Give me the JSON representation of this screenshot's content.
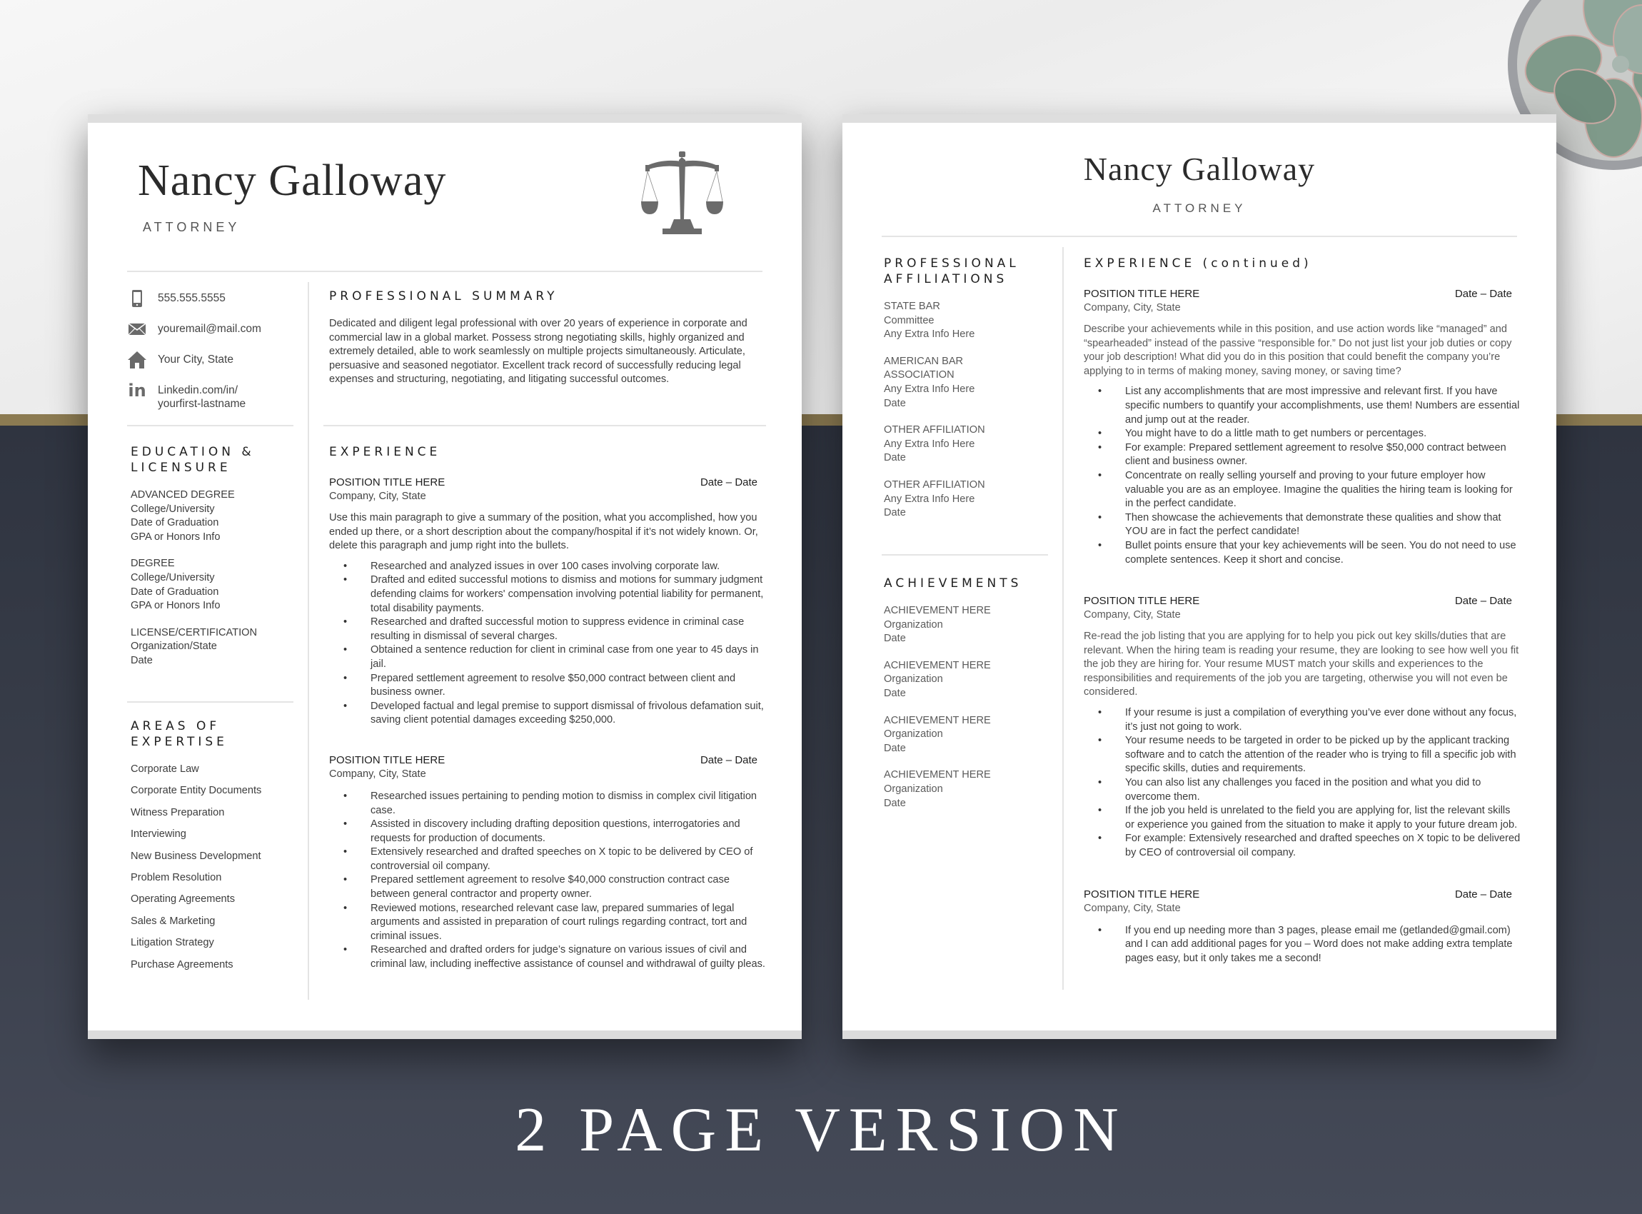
{
  "caption": "2 PAGE VERSION",
  "colors": {
    "gold_band": "#8c7b52",
    "dark_bg": "#353a46",
    "heading": "#1e1e1e",
    "body_text": "#3d3d3d"
  },
  "page1": {
    "name": "Nancy Galloway",
    "title": "ATTORNEY",
    "logo_icon": "scales-of-justice-icon",
    "contact": [
      {
        "icon": "phone-icon",
        "text": "555.555.5555"
      },
      {
        "icon": "mail-icon",
        "text": "youremail@mail.com"
      },
      {
        "icon": "home-icon",
        "text": "Your City, State"
      },
      {
        "icon": "linkedin-icon",
        "line1": "Linkedin.com/in/",
        "line2": "yourfirst-lastname"
      }
    ],
    "education": {
      "heading_line1": "EDUCATION &",
      "heading_line2": "LICENSURE",
      "entries": [
        {
          "title": "ADVANCED DEGREE",
          "lines": [
            "College/University",
            "Date of Graduation",
            "GPA or Honors Info"
          ]
        },
        {
          "title": "DEGREE",
          "lines": [
            "College/University",
            "Date of Graduation",
            "GPA or Honors Info"
          ]
        },
        {
          "title": "LICENSE/CERTIFICATION",
          "lines": [
            "Organization/State",
            "Date"
          ]
        }
      ]
    },
    "expertise": {
      "heading_line1": "AREAS OF",
      "heading_line2": "EXPERTISE",
      "items": [
        "Corporate Law",
        "Corporate Entity Documents",
        "Witness Preparation",
        "Interviewing",
        "New Business Development",
        "Problem Resolution",
        "Operating Agreements",
        "Sales & Marketing",
        "Litigation Strategy",
        "Purchase Agreements"
      ]
    },
    "summary": {
      "heading": "PROFESSIONAL SUMMARY",
      "text": "Dedicated and diligent legal professional with over 20 years of experience in corporate and commercial law in a global market.  Possess strong negotiating skills, highly organized and extremely detailed, able to work seamlessly on multiple projects simultaneously.  Articulate, persuasive and seasoned negotiator.  Excellent track record of successfully reducing legal expenses and structuring, negotiating, and litigating successful outcomes."
    },
    "experience": {
      "heading": "EXPERIENCE",
      "jobs": [
        {
          "title": "POSITION TITLE HERE",
          "dates": "Date – Date",
          "company": "Company, City, State",
          "summary": "Use this main paragraph to give a summary of the position, what you accomplished, how you ended up there, or a short description about the company/hospital if it’s not widely known.  Or, delete this paragraph and jump right into the bullets.",
          "bullets": [
            "Researched and analyzed issues in over 100 cases involving corporate law.",
            "Drafted and edited successful motions to dismiss and motions for summary judgment defending claims for workers' compensation involving potential liability for permanent, total disability payments.",
            "Researched and drafted successful motion to suppress evidence in criminal case resulting in dismissal of several charges.",
            "Obtained a sentence reduction for client in criminal case from one year to 45 days in jail.",
            "Prepared settlement agreement to resolve $50,000 contract between client and business owner.",
            "Developed factual and legal premise to support dismissal of frivolous defamation suit, saving client potential damages exceeding $250,000."
          ]
        },
        {
          "title": "POSITION TITLE HERE",
          "dates": "Date – Date",
          "company": "Company, City, State",
          "bullets": [
            "Researched issues pertaining to pending motion to dismiss in complex civil litigation case.",
            "Assisted in discovery including drafting deposition questions, interrogatories and requests for production of documents.",
            "Extensively researched and drafted speeches on X topic to be delivered by CEO of controversial oil company.",
            "Prepared settlement agreement to resolve $40,000 construction contract case between general contractor and property owner.",
            "Reviewed motions, researched relevant case law, prepared summaries of legal arguments and assisted in preparation of court rulings regarding contract, tort and criminal issues.",
            "Researched and drafted orders for judge’s signature on various issues of civil and criminal law, including ineffective assistance of counsel and withdrawal of guilty pleas."
          ]
        }
      ]
    }
  },
  "page2": {
    "name": "Nancy Galloway",
    "title": "ATTORNEY",
    "affiliations": {
      "heading_line1": "PROFESSIONAL",
      "heading_line2": "AFFILIATIONS",
      "entries": [
        {
          "lines": [
            "STATE BAR",
            "Committee",
            "Any Extra Info Here"
          ]
        },
        {
          "lines": [
            "AMERICAN BAR",
            "ASSOCIATION",
            "Any Extra Info Here",
            "Date"
          ]
        },
        {
          "lines": [
            "OTHER AFFILIATION",
            "Any Extra Info Here",
            "Date"
          ]
        },
        {
          "lines": [
            "OTHER AFFILIATION",
            "Any Extra Info Here",
            "Date"
          ]
        }
      ]
    },
    "achievements": {
      "heading": "ACHIEVEMENTS",
      "entries": [
        {
          "lines": [
            "ACHIEVEMENT HERE",
            "Organization",
            "Date"
          ]
        },
        {
          "lines": [
            "ACHIEVEMENT HERE",
            "Organization",
            "Date"
          ]
        },
        {
          "lines": [
            "ACHIEVEMENT HERE",
            "Organization",
            "Date"
          ]
        },
        {
          "lines": [
            "ACHIEVEMENT HERE",
            "Organization",
            "Date"
          ]
        }
      ]
    },
    "experience": {
      "heading": "EXPERIENCE (continued)",
      "jobs": [
        {
          "title": "POSITION TITLE HERE",
          "dates": "Date – Date",
          "company": "Company, City, State",
          "summary": "Describe your achievements while in this position, and use action words like “managed” and “spearheaded” instead of the passive “responsible for.”  Do not just list your job duties or copy your job description!  What did you do in this position that could benefit the company you’re applying to in terms of making money, saving money, or saving time?",
          "bullets": [
            "List any accomplishments that are most impressive and relevant first.  If you have specific numbers to quantify your accomplishments, use them!  Numbers are essential and jump out at the reader.",
            "You might have to do a little math to get numbers or percentages.",
            "For example: Prepared settlement agreement to resolve $50,000 contract between client and business owner.",
            "Concentrate on really selling yourself and proving to your future employer how valuable you are as an employee.  Imagine the qualities the hiring team is looking for in the perfect candidate.",
            "Then showcase the achievements that demonstrate these qualities and show that YOU are in fact the perfect candidate!",
            "Bullet points ensure that your key achievements will be seen.  You do not need to use complete sentences.  Keep it short and concise."
          ]
        },
        {
          "title": "POSITION TITLE HERE",
          "dates": "Date – Date",
          "company": "Company, City, State",
          "summary": "Re-read the job listing that you are applying for to help you pick out key skills/duties that are relevant.  When the hiring team is reading your resume, they are looking to see how well you fit the job they are hiring for.  Your resume MUST match your skills and experiences to the responsibilities and requirements of the job you are targeting, otherwise you will not even be considered.",
          "bullets": [
            "If your resume is just a compilation of everything you’ve ever done without any focus, it’s just not going to work.",
            "Your resume needs to be targeted in order to be picked up by the applicant tracking software and to catch the attention of the reader who is trying to fill a specific job with specific skills, duties and requirements.",
            "You can also list any challenges you faced in the position and what you did to overcome them.",
            "If the job you held is unrelated to the field you are applying for, list the relevant skills or experience you gained from the situation to make it apply to your future dream job.",
            "For example:  Extensively researched and drafted speeches on X topic to be delivered by CEO of controversial oil company."
          ]
        },
        {
          "title": "POSITION TITLE HERE",
          "dates": "Date – Date",
          "company": "Company, City, State",
          "bullets": [
            "If you end up needing more than 3 pages, please email me (getlanded@gmail.com) and I can add additional pages for you – Word does not make adding extra template pages easy, but it only takes me a second!"
          ]
        }
      ]
    }
  }
}
